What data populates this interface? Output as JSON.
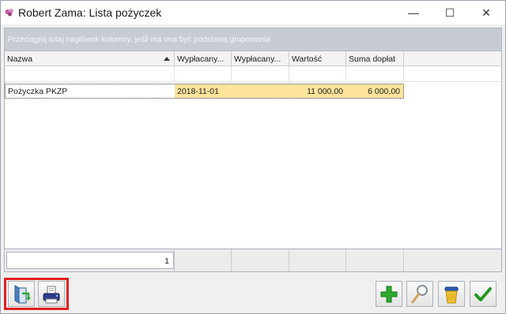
{
  "window": {
    "title": "Robert Zama: Lista pożyczek",
    "minimize_symbol": "—",
    "maximize_symbol": "☐",
    "close_symbol": "✕"
  },
  "grouping": {
    "hint": "Przeciągnij tutaj nagłówek kolumny, jeśli ma ona być podstawą grupowania"
  },
  "table": {
    "columns": [
      "Nazwa",
      "Wypłacany...",
      "Wypłacany...",
      "Wartość",
      "Suma dopłat"
    ],
    "sort_column": "Nazwa",
    "rows": [
      {
        "nazwa": "Pożyczka PKZP",
        "wyplacany1": "2018-11-01",
        "wyplacany2": "",
        "wartosc": "11 000,00",
        "suma_doplat": "6 000,00"
      }
    ],
    "footer": {
      "count": "1"
    }
  },
  "toolbar": {
    "left_icons": [
      "document-icon",
      "print-icon"
    ],
    "right_icons": [
      "add-icon",
      "search-icon",
      "delete-icon",
      "confirm-icon"
    ]
  },
  "colors": {
    "row_highlight": "#fde49b",
    "grouping_bar": "#c7ccd3",
    "selection_border": "#e02020",
    "add_green": "#2eaa2e",
    "confirm_green": "#1f9a1f"
  }
}
